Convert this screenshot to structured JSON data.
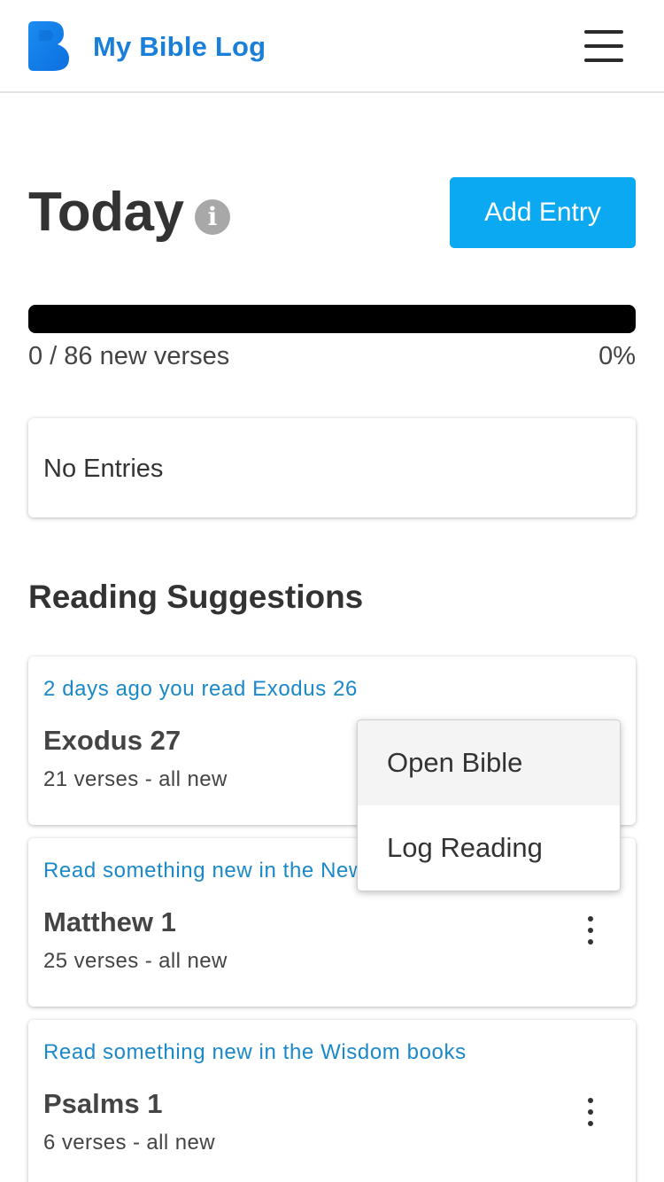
{
  "app": {
    "title": "My Bible Log",
    "logo_icon": "blue-letter-b-logo",
    "menu_icon": "hamburger-menu-icon",
    "colors": {
      "brand": "#1a7fd9",
      "accent": "#0aa9f2",
      "progress_track": "#000000"
    }
  },
  "today": {
    "title": "Today",
    "info_icon": "i",
    "add_entry_label": "Add Entry",
    "progress": {
      "fraction": 0.0,
      "label": "0 / 86 new verses",
      "percent_label": "0%"
    },
    "no_entries_text": "No Entries"
  },
  "suggestions": {
    "title": "Reading Suggestions",
    "items": [
      {
        "reason": "2 days ago you read Exodus 26",
        "reference": "Exodus 27",
        "count": "21 verses - all new"
      },
      {
        "reason": "Read something new in the New Testament",
        "reference": "Matthew 1",
        "count": "25 verses - all new"
      },
      {
        "reason": "Read something new in the Wisdom books",
        "reference": "Psalms 1",
        "count": "6 verses - all new"
      }
    ]
  },
  "dropdown": {
    "options": [
      "Open Bible",
      "Log Reading"
    ]
  }
}
